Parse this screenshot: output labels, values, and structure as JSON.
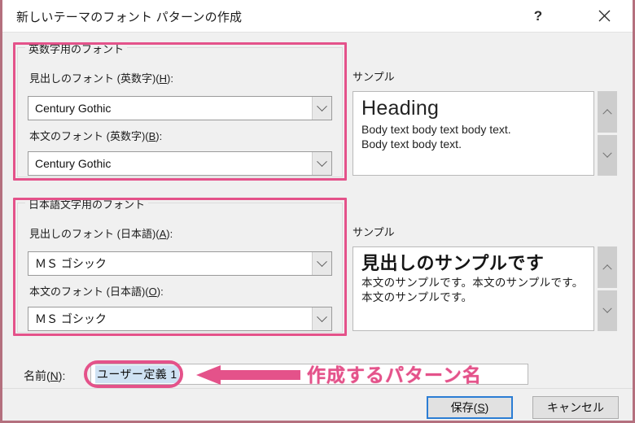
{
  "window": {
    "title": "新しいテーマのフォント パターンの作成",
    "help_icon": "question-mark-icon",
    "close_icon": "close-x-icon",
    "frame_color": "#b4707e"
  },
  "annotation": {
    "highlight_color": "#e4528a",
    "arrow_icon": "left-arrow-icon",
    "caption": "作成するパターン名"
  },
  "latin_group": {
    "legend": "英数字用のフォント",
    "heading_label_pre": "見出しのフォント (英数字)(",
    "heading_label_key": "H",
    "heading_label_post": "):",
    "heading_value": "Century Gothic",
    "body_label_pre": "本文のフォント (英数字)(",
    "body_label_key": "B",
    "body_label_post": "):",
    "body_value": "Century Gothic",
    "dropdown_icon": "chevron-down-icon"
  },
  "latin_sample": {
    "label": "サンプル",
    "heading": "Heading",
    "body_line1": "Body text body text body text.",
    "body_line2": "Body text body text.",
    "scroll_up_icon": "chevron-up-icon",
    "scroll_down_icon": "chevron-down-icon"
  },
  "jp_group": {
    "legend": "日本語文字用のフォント",
    "heading_label_pre": "見出しのフォント (日本語)(",
    "heading_label_key": "A",
    "heading_label_post": "):",
    "heading_value": "ＭＳ ゴシック",
    "body_label_pre": "本文のフォント (日本語)(",
    "body_label_key": "O",
    "body_label_post": "):",
    "body_value": "ＭＳ ゴシック",
    "dropdown_icon": "chevron-down-icon"
  },
  "jp_sample": {
    "label": "サンプル",
    "heading": "見出しのサンプルです",
    "body": "本文のサンプルです。本文のサンプルです。本文のサンプルです。",
    "scroll_up_icon": "chevron-up-icon",
    "scroll_down_icon": "chevron-down-icon"
  },
  "name_row": {
    "label_pre": "名前(",
    "label_key": "N",
    "label_post": "):",
    "value": "ユーザー定義 1",
    "selection_color": "#cfe2f3"
  },
  "footer": {
    "save_pre": "保存(",
    "save_key": "S",
    "save_post": ")",
    "cancel": "キャンセル",
    "focus_color": "#2b7dd4"
  }
}
